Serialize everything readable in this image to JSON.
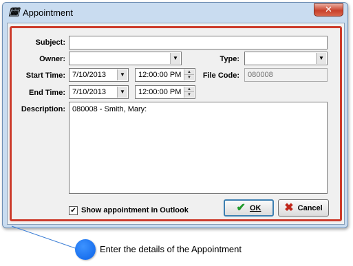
{
  "window": {
    "title": "Appointment",
    "close_glyph": "✕",
    "app_icon": "app-logo-icon"
  },
  "form": {
    "subject_label": "Subject:",
    "subject_value": "",
    "owner_label": "Owner:",
    "owner_value": "",
    "type_label": "Type:",
    "type_value": "",
    "start_time_label": "Start Time:",
    "start_date": "7/10/2013",
    "start_time": "12:00:00 PM",
    "file_code_label": "File Code:",
    "file_code_value": "080008",
    "end_time_label": "End Time:",
    "end_date": "7/10/2013",
    "end_time": "12:00:00 PM",
    "description_label": "Description:",
    "description_value": "080008 - Smith, Mary:",
    "outlook_checkbox_label": "Show appointment in Outlook",
    "outlook_checked": true
  },
  "buttons": {
    "ok_label": "OK",
    "cancel_label": "Cancel"
  },
  "callout": {
    "text": "Enter the details of the Appointment",
    "color": "#0b62e8"
  },
  "colors": {
    "highlight_frame": "#cc3b2b",
    "window_chrome": "#c9dcf0",
    "close_button": "#c8412b"
  }
}
